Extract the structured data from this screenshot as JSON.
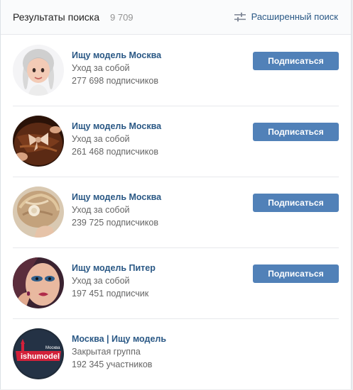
{
  "header": {
    "title": "Результаты поиска",
    "count": "9 709",
    "advanced_label": "Расширенный поиск"
  },
  "results": [
    {
      "name": "Ищу модель Москва",
      "type": "Уход за собой",
      "members": "277 698 подписчиков",
      "button": "Подписаться",
      "avatar_icon": "memoji-girl-braids-avatar"
    },
    {
      "name": "Ищу модель Москва",
      "type": "Уход за собой",
      "members": "261 468 подписчиков",
      "button": "Подписаться",
      "avatar_icon": "hair-bow-avatar"
    },
    {
      "name": "Ищу модель Москва",
      "type": "Уход за собой",
      "members": "239 725 подписчиков",
      "button": "Подписаться",
      "avatar_icon": "hairstyle-flower-avatar"
    },
    {
      "name": "Ищу модель Питер",
      "type": "Уход за собой",
      "members": "197 451 подписчик",
      "button": "Подписаться",
      "avatar_icon": "makeup-face-avatar"
    },
    {
      "name": "Москва | Ищу модель",
      "type": "Закрытая группа",
      "members": "192 345 участников",
      "avatar_icon": "ishumodel-logo-avatar",
      "logo_text": "ishumodel",
      "logo_small_text": "Москва"
    }
  ],
  "colors": {
    "accent": "#5181b8",
    "link": "#2a5885",
    "muted": "#656565"
  }
}
